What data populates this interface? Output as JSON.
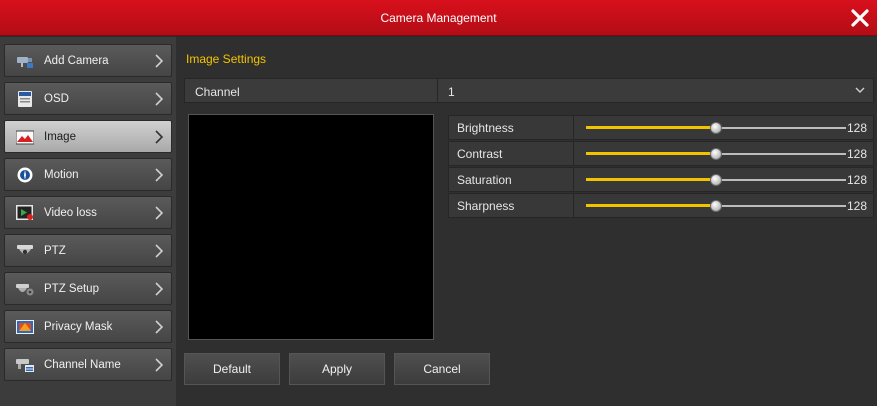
{
  "window": {
    "title": "Camera Management",
    "close_icon": "close-icon"
  },
  "sidebar": {
    "items": [
      {
        "label": "Add Camera",
        "icon": "add-camera-icon",
        "active": false
      },
      {
        "label": "OSD",
        "icon": "osd-icon",
        "active": false
      },
      {
        "label": "Image",
        "icon": "image-icon",
        "active": true
      },
      {
        "label": "Motion",
        "icon": "motion-icon",
        "active": false
      },
      {
        "label": "Video loss",
        "icon": "video-loss-icon",
        "active": false
      },
      {
        "label": "PTZ",
        "icon": "ptz-icon",
        "active": false
      },
      {
        "label": "PTZ Setup",
        "icon": "ptz-setup-icon",
        "active": false
      },
      {
        "label": "Privacy Mask",
        "icon": "privacy-mask-icon",
        "active": false
      },
      {
        "label": "Channel Name",
        "icon": "channel-name-icon",
        "active": false
      }
    ]
  },
  "main": {
    "section_title": "Image Settings",
    "channel": {
      "label": "Channel",
      "value": "1"
    },
    "sliders": [
      {
        "label": "Brightness",
        "value": "128",
        "level": 0.5
      },
      {
        "label": "Contrast",
        "value": "128",
        "level": 0.5
      },
      {
        "label": "Saturation",
        "value": "128",
        "level": 0.5
      },
      {
        "label": "Sharpness",
        "value": "128",
        "level": 0.5
      }
    ],
    "buttons": {
      "default": "Default",
      "apply": "Apply",
      "cancel": "Cancel"
    }
  },
  "colors": {
    "title_bar": "#c8101a",
    "accent": "#f2c400",
    "panel": "#2f2f2f",
    "sidebar": "#3c3c3c"
  }
}
